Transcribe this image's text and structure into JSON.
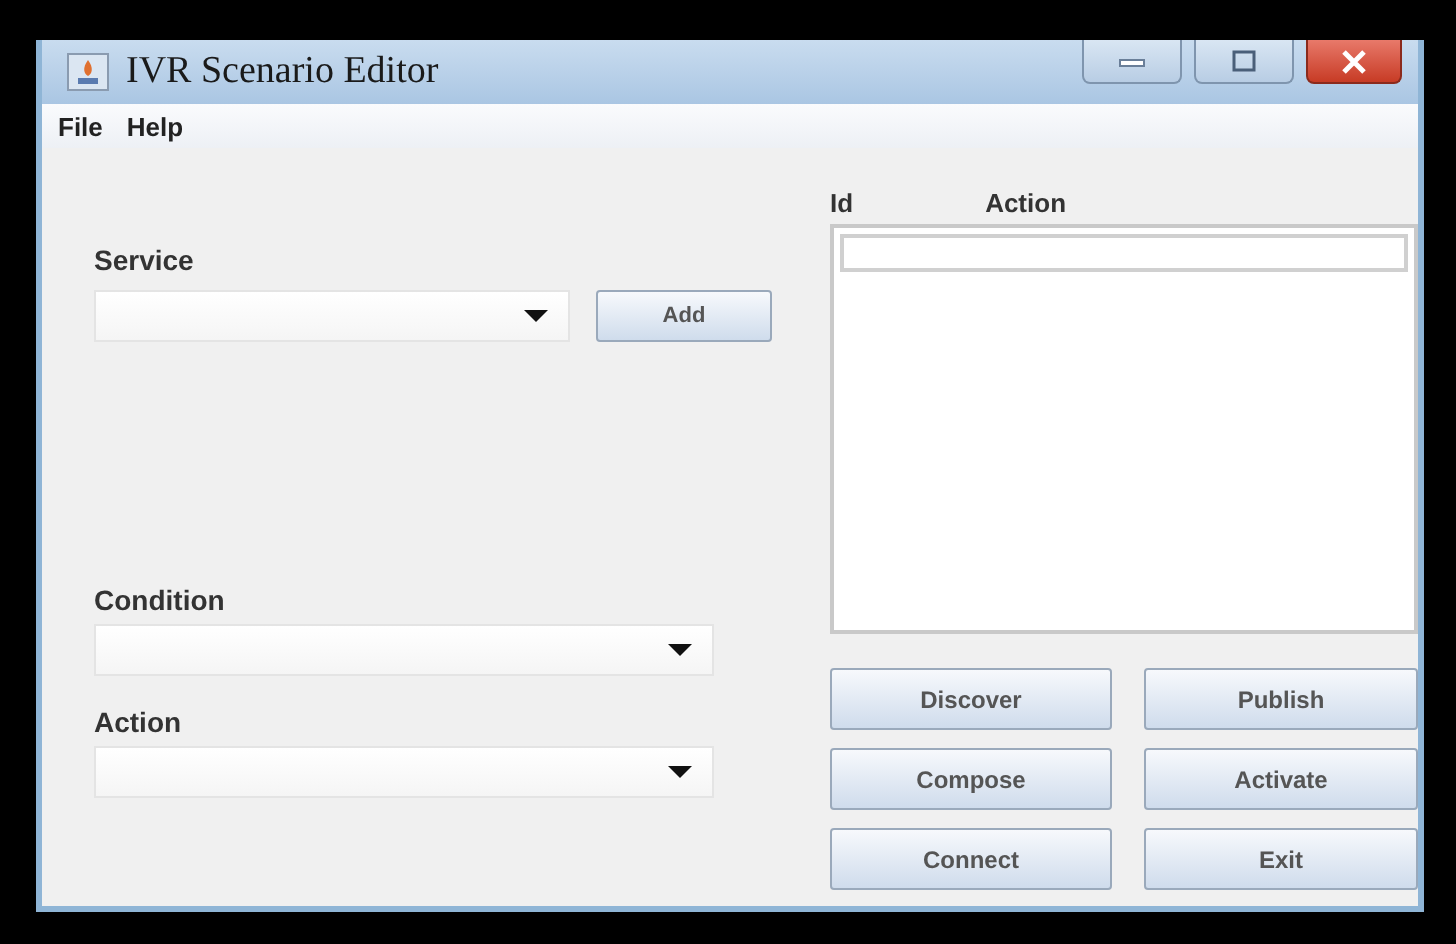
{
  "window": {
    "title": "IVR Scenario Editor"
  },
  "menu": [
    {
      "label": "File"
    },
    {
      "label": "Help"
    }
  ],
  "service": {
    "label": "Service",
    "button": "Add"
  },
  "condition": {
    "label": "Condition"
  },
  "action": {
    "label": "Action"
  },
  "table": {
    "columns": [
      "Id",
      "Action"
    ]
  },
  "buttons": [
    "Discover",
    "Publish",
    "Compose",
    "Activate",
    "Connect",
    "Exit"
  ]
}
